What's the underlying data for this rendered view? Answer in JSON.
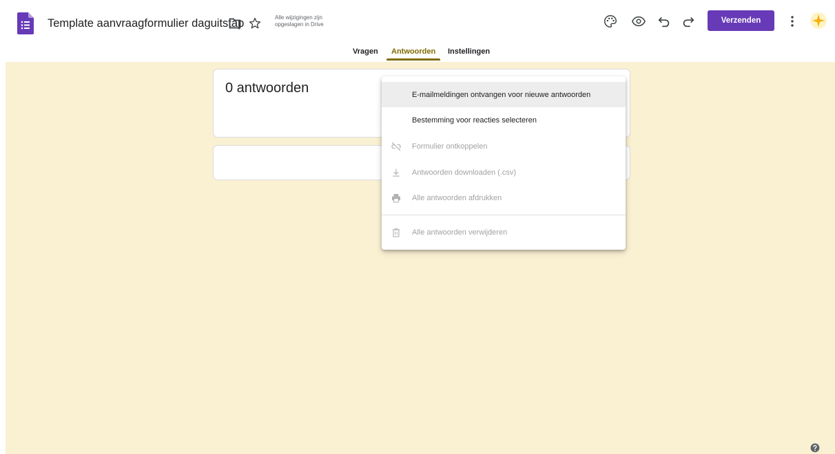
{
  "header": {
    "title": "Template aanvraagformulier daguitstap",
    "save_status_line1": "Alle wijzigingen zijn",
    "save_status_line2": "opgeslagen in Drive",
    "send_label": "Verzenden",
    "brand_color": "#673ab7",
    "icons": [
      "forms-app-icon",
      "folder-icon",
      "star-icon",
      "palette-icon",
      "preview-eye-icon",
      "undo-icon",
      "redo-icon",
      "more-vert-icon",
      "account-avatar-icon"
    ]
  },
  "tabs": [
    {
      "label": "Vragen",
      "active": false
    },
    {
      "label": "Antwoorden",
      "active": true
    },
    {
      "label": "Instellingen",
      "active": false
    }
  ],
  "responses": {
    "count_label": "0 antwoorden"
  },
  "menu": {
    "items": [
      {
        "label": "E-mailmeldingen ontvangen voor nieuwe antwoorden",
        "enabled": true,
        "icon": null
      },
      {
        "label": "Bestemming voor reacties selecteren",
        "enabled": true,
        "icon": null
      },
      {
        "label": "Formulier ontkoppelen",
        "enabled": false,
        "icon": "link-off-icon"
      },
      {
        "label": "Antwoorden downloaden (.csv)",
        "enabled": false,
        "icon": "download-icon"
      },
      {
        "label": "Alle antwoorden afdrukken",
        "enabled": false,
        "icon": "print-icon"
      },
      {
        "label": "Alle antwoorden verwijderen",
        "enabled": false,
        "icon": "trash-icon"
      }
    ]
  },
  "colors": {
    "accent": "#806a00",
    "background": "#faf0d2"
  }
}
